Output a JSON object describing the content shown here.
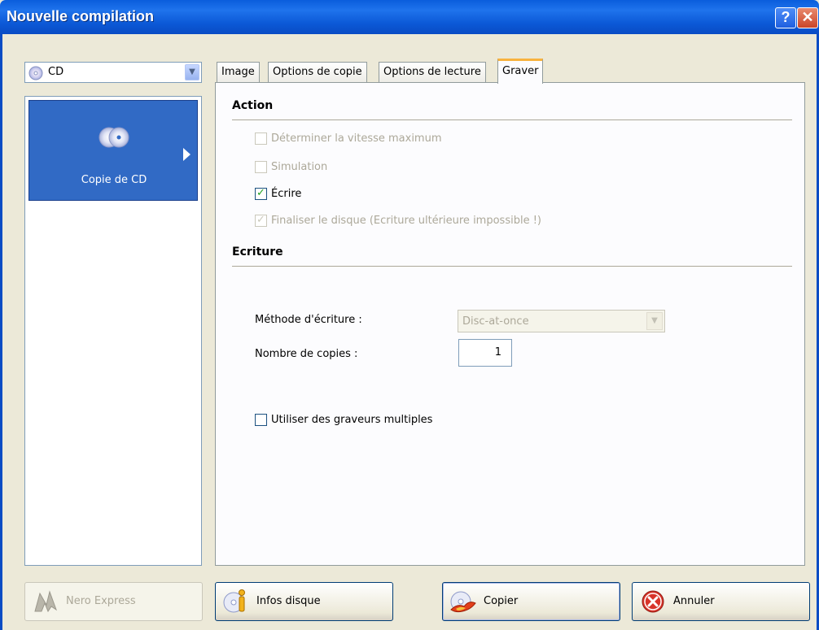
{
  "window": {
    "title": "Nouvelle compilation",
    "help_button": "?",
    "close_button": "✕"
  },
  "media_combo": {
    "value": "CD",
    "icon": "cd-icon"
  },
  "left_panel": {
    "items": [
      {
        "label": "Copie de CD",
        "icon": "two-discs-icon",
        "selected": true
      }
    ]
  },
  "tabs": [
    {
      "label": "Image"
    },
    {
      "label": "Options de copie"
    },
    {
      "label": "Options de lecture"
    },
    {
      "label": "Graver",
      "active": true
    }
  ],
  "action_section": {
    "title": "Action",
    "checkboxes": [
      {
        "label": "Déterminer la vitesse maximum",
        "checked": false,
        "enabled": false
      },
      {
        "label": "Simulation",
        "checked": false,
        "enabled": false
      },
      {
        "label": "Écrire",
        "checked": true,
        "enabled": true
      },
      {
        "label": "Finaliser le disque (Ecriture ultérieure impossible !)",
        "checked": true,
        "enabled": false
      }
    ]
  },
  "ecriture_section": {
    "title": "Ecriture",
    "method_label": "Méthode d'écriture :",
    "method_value": "Disc-at-once",
    "copies_label": "Nombre de copies :",
    "copies_value": "1",
    "multi_writers_label": "Utiliser des graveurs multiples"
  },
  "buttons": {
    "nero_express": "Nero Express",
    "infos_disque": "Infos disque",
    "copier": "Copier",
    "annuler": "Annuler"
  }
}
